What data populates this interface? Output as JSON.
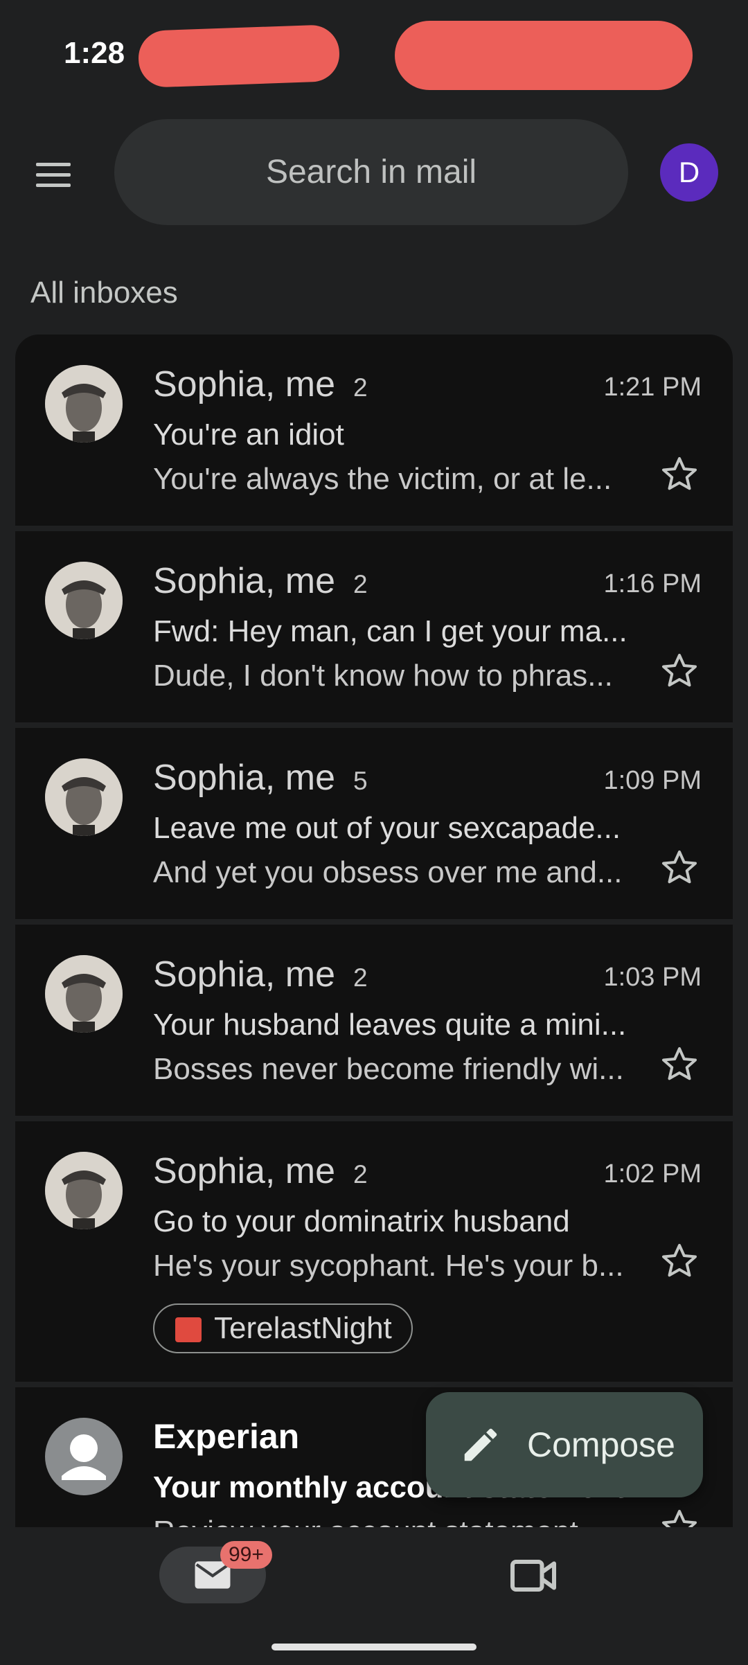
{
  "status_bar": {
    "time": "1:28"
  },
  "search": {
    "placeholder": "Search in mail"
  },
  "account": {
    "initial": "D"
  },
  "section_title": "All inboxes",
  "emails": [
    {
      "sender": "Sophia, me",
      "count": "2",
      "time": "1:21 PM",
      "subject": "You're an idiot",
      "snippet": "You're always the victim, or at le...",
      "unread": false
    },
    {
      "sender": "Sophia, me",
      "count": "2",
      "time": "1:16 PM",
      "subject": "Fwd: Hey man, can I get your ma...",
      "snippet": "Dude, I don't know how to phras...",
      "unread": false
    },
    {
      "sender": "Sophia, me",
      "count": "5",
      "time": "1:09 PM",
      "subject": "Leave me out of your sexcapade...",
      "snippet": "And yet you obsess over me and...",
      "unread": false
    },
    {
      "sender": "Sophia, me",
      "count": "2",
      "time": "1:03 PM",
      "subject": "Your husband leaves quite a mini...",
      "snippet": "Bosses never become friendly wi...",
      "unread": false
    },
    {
      "sender": "Sophia, me",
      "count": "2",
      "time": "1:02 PM",
      "subject": "Go to your dominatrix husband",
      "snippet": "He's your sycophant. He's your b...",
      "attachment": "TerelastNight",
      "unread": false
    },
    {
      "sender": "Experian",
      "count": "",
      "time": "",
      "subject": "Your monthly account statement",
      "snippet": "Review your account statement",
      "unread": true
    }
  ],
  "fab": {
    "label": "Compose"
  },
  "bottom_nav": {
    "mail_badge": "99+"
  }
}
